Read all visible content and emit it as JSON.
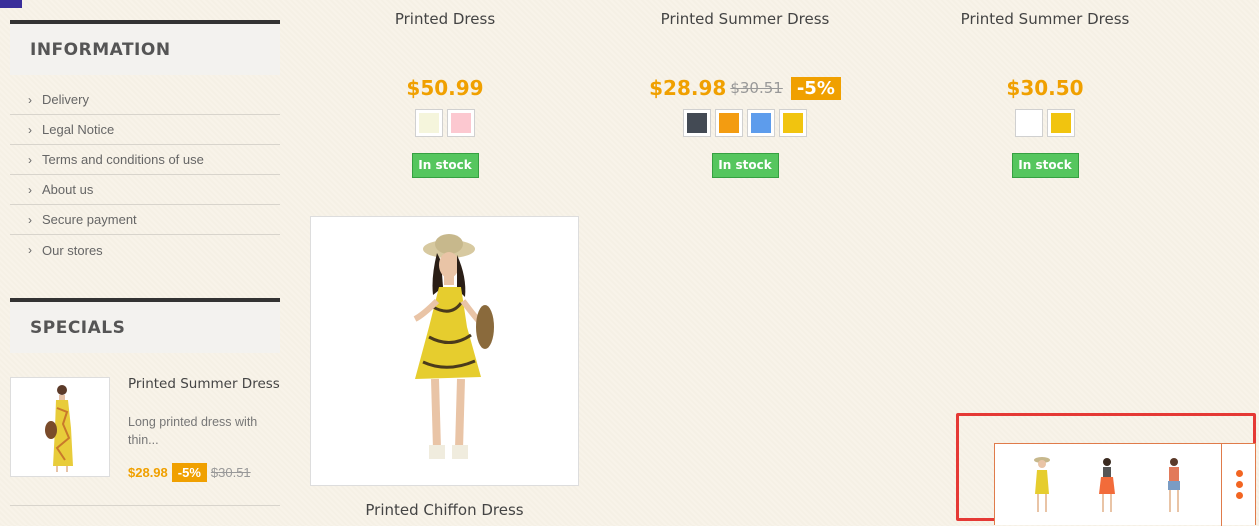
{
  "sidebar": {
    "information": {
      "title": "INFORMATION",
      "links": [
        "Delivery",
        "Legal Notice",
        "Terms and conditions of use",
        "About us",
        "Secure payment",
        "Our stores"
      ]
    },
    "specials": {
      "title": "SPECIALS",
      "item": {
        "name": "Printed Summer Dress",
        "description_line1": "Long printed dress with",
        "description_line2": "thin...",
        "price": "$28.98",
        "discount": "-5%",
        "old_price": "$30.51"
      }
    }
  },
  "products": [
    {
      "name": "Printed Dress",
      "price": "$50.99",
      "old_price": "",
      "discount": "",
      "swatches": [
        "#f5f5dc",
        "#fcc8d0"
      ],
      "stock": "In stock"
    },
    {
      "name": "Printed Summer Dress",
      "price": "$28.98",
      "old_price": "$30.51",
      "discount": "-5%",
      "swatches": [
        "#434a54",
        "#f39c11",
        "#5d9cec",
        "#f1c40f"
      ],
      "stock": "In stock"
    },
    {
      "name": "Printed Summer Dress",
      "price": "$30.50",
      "old_price": "",
      "discount": "",
      "swatches": [
        "#ffffff",
        "#f1c40f"
      ],
      "stock": "In stock"
    },
    {
      "name": "Printed Chiffon Dress"
    }
  ],
  "viewed_widget": {
    "thumbnails": [
      "yellow-dress",
      "orange-dress",
      "denim-shorts-outfit"
    ],
    "menu_icon": "vertical-dots-icon"
  },
  "colors": {
    "price": "#f0a000",
    "in_stock": "#55c65e",
    "highlight": "#e53935",
    "widget_accent": "#f26522"
  }
}
